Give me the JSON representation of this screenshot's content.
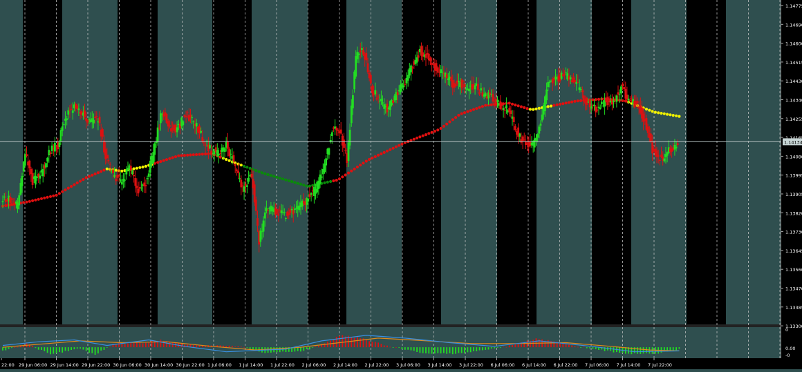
{
  "colors": {
    "background": "#2f4f4f",
    "session_band": "#000000",
    "grid": "#c8c8c8",
    "bull_candle": "#22dd22",
    "bear_candle": "#dd1111",
    "ma_down": "#e01010",
    "ma_flat": "#f2f200",
    "ma_up": "#0a8a0a",
    "price_line": "#b4c0c0",
    "price_label_bg": "#c8d6d6",
    "price_label_text": "#000000",
    "axis_text": "#ffffff",
    "macd_signal": "#e08a1a",
    "macd_line": "#3a8fe0"
  },
  "chart_data": [
    {
      "type": "candlestick",
      "title": "",
      "ylim": [
        1.133,
        1.14775
      ],
      "grid": true,
      "y_tick_labels": [
        "1.14775",
        "1.14690",
        "1.14600",
        "1.14515",
        "1.14430",
        "1.14340",
        "1.14255",
        "1.14165",
        "1.14080",
        "1.13995",
        "1.13905",
        "1.13820",
        "1.13730",
        "1.13645",
        "1.13560",
        "1.13470",
        "1.13385",
        "1.13300"
      ],
      "x_tick_labels": [
        "22:00",
        "29 Jun 06:00",
        "29 Jun 14:00",
        "29 Jun 22:00",
        "30 Jun 06:00",
        "30 Jun 14:00",
        "30 Jun 22:00",
        "1 Jul 06:00",
        "1 Jul 14:00",
        "1 Jul 22:00",
        "2 Jul 06:00",
        "2 Jul 14:00",
        "2 Jul 22:00",
        "3 Jul 06:00",
        "3 Jul 14:00",
        "3 Jul 22:00",
        "6 Jul 06:00",
        "6 Jul 14:00",
        "6 Jul 22:00",
        "7 Jul 06:00",
        "7 Jul 14:00",
        "7 Jul 22:00"
      ],
      "current_price": "1.14134",
      "price_path": [
        [
          0,
          1.1387
        ],
        [
          5,
          1.1387
        ],
        [
          11,
          1.1384
        ],
        [
          16,
          1.1408
        ],
        [
          21,
          1.1395
        ],
        [
          27,
          1.1399
        ],
        [
          32,
          1.1409
        ],
        [
          38,
          1.1412
        ],
        [
          43,
          1.1425
        ],
        [
          48,
          1.1429
        ],
        [
          54,
          1.1427
        ],
        [
          59,
          1.1422
        ],
        [
          65,
          1.1424
        ],
        [
          70,
          1.1407
        ],
        [
          75,
          1.1398
        ],
        [
          81,
          1.1395
        ],
        [
          86,
          1.1402
        ],
        [
          92,
          1.1391
        ],
        [
          97,
          1.1395
        ],
        [
          102,
          1.1408
        ],
        [
          108,
          1.1428
        ],
        [
          113,
          1.1419
        ],
        [
          119,
          1.142
        ],
        [
          124,
          1.1426
        ],
        [
          130,
          1.1422
        ],
        [
          135,
          1.1415
        ],
        [
          140,
          1.141
        ],
        [
          146,
          1.1408
        ],
        [
          151,
          1.1412
        ],
        [
          157,
          1.1402
        ],
        [
          162,
          1.1392
        ],
        [
          168,
          1.1398
        ],
        [
          173,
          1.1368
        ],
        [
          178,
          1.1383
        ],
        [
          184,
          1.1382
        ],
        [
          189,
          1.138
        ],
        [
          195,
          1.1381
        ],
        [
          200,
          1.1383
        ],
        [
          205,
          1.1387
        ],
        [
          211,
          1.1392
        ],
        [
          216,
          1.14
        ],
        [
          222,
          1.1418
        ],
        [
          227,
          1.1419
        ],
        [
          232,
          1.1405
        ],
        [
          238,
          1.1452
        ],
        [
          243,
          1.1455
        ],
        [
          249,
          1.1437
        ],
        [
          254,
          1.1432
        ],
        [
          259,
          1.1428
        ],
        [
          265,
          1.1435
        ],
        [
          270,
          1.144
        ],
        [
          276,
          1.1449
        ],
        [
          281,
          1.1455
        ],
        [
          286,
          1.1452
        ],
        [
          292,
          1.1447
        ],
        [
          297,
          1.1444
        ],
        [
          303,
          1.144
        ],
        [
          308,
          1.144
        ],
        [
          313,
          1.1438
        ],
        [
          319,
          1.1438
        ],
        [
          324,
          1.1435
        ],
        [
          330,
          1.1433
        ],
        [
          335,
          1.143
        ],
        [
          340,
          1.1428
        ],
        [
          346,
          1.1418
        ],
        [
          351,
          1.1413
        ],
        [
          357,
          1.1412
        ],
        [
          362,
          1.1422
        ],
        [
          367,
          1.144
        ],
        [
          373,
          1.1442
        ],
        [
          378,
          1.1444
        ],
        [
          384,
          1.1441
        ],
        [
          389,
          1.1437
        ],
        [
          394,
          1.143
        ],
        [
          400,
          1.1428
        ],
        [
          405,
          1.1432
        ],
        [
          411,
          1.1432
        ],
        [
          416,
          1.1438
        ],
        [
          421,
          1.1433
        ],
        [
          427,
          1.143
        ],
        [
          432,
          1.1423
        ],
        [
          437,
          1.141
        ],
        [
          443,
          1.1405
        ],
        [
          448,
          1.1409
        ],
        [
          454,
          1.1413
        ]
      ],
      "ma_path": [
        [
          0,
          1.1384
        ],
        [
          17,
          1.1386
        ],
        [
          36,
          1.1389
        ],
        [
          56,
          1.1397
        ],
        [
          70,
          1.1401
        ],
        [
          80,
          1.14
        ],
        [
          95,
          1.1402
        ],
        [
          118,
          1.1407
        ],
        [
          140,
          1.1408
        ],
        [
          155,
          1.1404
        ],
        [
          175,
          1.1399
        ],
        [
          190,
          1.1396
        ],
        [
          205,
          1.1393
        ],
        [
          225,
          1.1396
        ],
        [
          245,
          1.1405
        ],
        [
          270,
          1.1413
        ],
        [
          293,
          1.1419
        ],
        [
          307,
          1.1426
        ],
        [
          324,
          1.143
        ],
        [
          340,
          1.1431
        ],
        [
          355,
          1.1428
        ],
        [
          370,
          1.143
        ],
        [
          385,
          1.1432
        ],
        [
          404,
          1.1433
        ],
        [
          418,
          1.1432
        ],
        [
          437,
          1.1427
        ],
        [
          454,
          1.1425
        ]
      ],
      "ma_segments": [
        {
          "state": "down",
          "from": 0,
          "to": 70
        },
        {
          "state": "flat",
          "from": 70,
          "to": 102
        },
        {
          "state": "down",
          "from": 102,
          "to": 148
        },
        {
          "state": "flat",
          "from": 148,
          "to": 162
        },
        {
          "state": "up",
          "from": 162,
          "to": 222
        },
        {
          "state": "down",
          "from": 222,
          "to": 354
        },
        {
          "state": "flat",
          "from": 354,
          "to": 370
        },
        {
          "state": "down",
          "from": 370,
          "to": 420
        },
        {
          "state": "flat",
          "from": 420,
          "to": 454
        }
      ]
    },
    {
      "type": "histogram",
      "title": "",
      "ylim": [
        -0.0012,
        0.0022
      ],
      "y_tick_labels": [
        "0",
        "0.00",
        "-0"
      ],
      "hist_path": [
        [
          0,
          -0.0004
        ],
        [
          16,
          0.0004
        ],
        [
          32,
          -0.0008
        ],
        [
          52,
          -0.0001
        ],
        [
          62,
          -0.0008
        ],
        [
          75,
          0.0004
        ],
        [
          96,
          0.0005
        ],
        [
          106,
          0.0008
        ],
        [
          121,
          0.0003
        ],
        [
          140,
          0.0002
        ],
        [
          160,
          0.0001
        ],
        [
          176,
          -0.0006
        ],
        [
          202,
          -0.0004
        ],
        [
          211,
          0.0001
        ],
        [
          227,
          0.0013
        ],
        [
          240,
          0.001
        ],
        [
          257,
          0.0002
        ],
        [
          284,
          -0.0007
        ],
        [
          305,
          -0.0007
        ],
        [
          336,
          0.0
        ],
        [
          358,
          0.0009
        ],
        [
          372,
          0.0006
        ],
        [
          389,
          0.0
        ],
        [
          418,
          -0.0007
        ],
        [
          440,
          -0.0007
        ],
        [
          454,
          -0.0002
        ]
      ],
      "blue_path": [
        [
          0,
          0.0002
        ],
        [
          24,
          0.0006
        ],
        [
          48,
          0.0008
        ],
        [
          70,
          0.0002
        ],
        [
          98,
          0.0008
        ],
        [
          122,
          0.0001
        ],
        [
          150,
          -0.0005
        ],
        [
          190,
          -0.0002
        ],
        [
          214,
          0.0007
        ],
        [
          244,
          0.0013
        ],
        [
          270,
          0.001
        ],
        [
          300,
          0.0005
        ],
        [
          330,
          0.0001
        ],
        [
          360,
          0.0007
        ],
        [
          395,
          0.0001
        ],
        [
          424,
          -0.0005
        ],
        [
          454,
          -0.0004
        ]
      ],
      "orange_path": [
        [
          0,
          0.0
        ],
        [
          30,
          0.0004
        ],
        [
          52,
          0.0007
        ],
        [
          80,
          0.0005
        ],
        [
          110,
          0.0006
        ],
        [
          140,
          0.0001
        ],
        [
          170,
          -0.0003
        ],
        [
          200,
          0.0
        ],
        [
          226,
          0.0005
        ],
        [
          252,
          0.001
        ],
        [
          285,
          0.0007
        ],
        [
          315,
          0.0004
        ],
        [
          345,
          0.0004
        ],
        [
          378,
          0.0005
        ],
        [
          408,
          0.0001
        ],
        [
          434,
          -0.0003
        ],
        [
          454,
          -0.0004
        ]
      ]
    }
  ]
}
